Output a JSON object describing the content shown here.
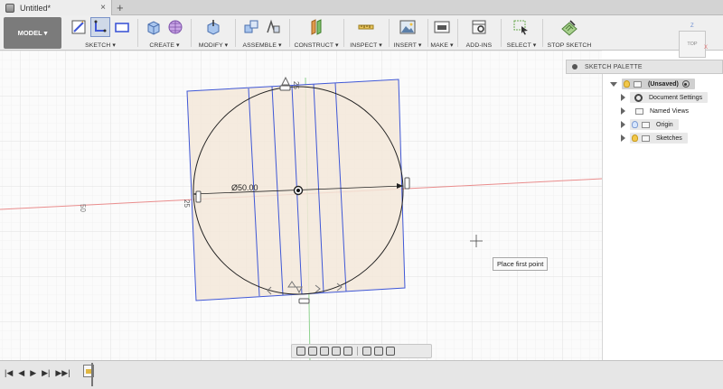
{
  "window": {
    "tab_title": "Untitled*",
    "tab_close": "×",
    "tab_add": "+"
  },
  "toolbar": {
    "model_label": "MODEL ▾",
    "groups": {
      "sketch": "SKETCH ▾",
      "create": "CREATE ▾",
      "modify": "MODIFY ▾",
      "assemble": "ASSEMBLE ▾",
      "construct": "CONSTRUCT ▾",
      "inspect": "INSPECT ▾",
      "insert": "INSERT ▾",
      "make": "MAKE ▾",
      "addins": "ADD-INS",
      "select": "SELECT ▾",
      "stop_sketch": "STOP SKETCH"
    }
  },
  "palette": {
    "title": "SKETCH PALETTE"
  },
  "view_cube": {
    "face": "TOP",
    "axis_x": "X",
    "axis_z": "Z"
  },
  "browser": {
    "items": [
      {
        "label": "(Unsaved)",
        "expanded": true
      },
      {
        "label": "Document Settings"
      },
      {
        "label": "Named Views"
      },
      {
        "label": "Origin"
      },
      {
        "label": "Sketches"
      }
    ]
  },
  "sketch": {
    "diameter_dim": "Ø50.00",
    "dim_top": "25",
    "dim_left": "25",
    "axis_label": "50"
  },
  "tooltip": {
    "text": "Place first point"
  },
  "timeline": {
    "controls": [
      "|◀",
      "◀",
      "▶",
      "▶|",
      "▶▶|"
    ]
  },
  "colors": {
    "sketch_blue": "#3f57d6",
    "profile_fill": "#f3e7d9",
    "axis_red": "#e98c8c",
    "axis_green": "#8fd28f",
    "toolbar_active": "#cfd9e8"
  }
}
